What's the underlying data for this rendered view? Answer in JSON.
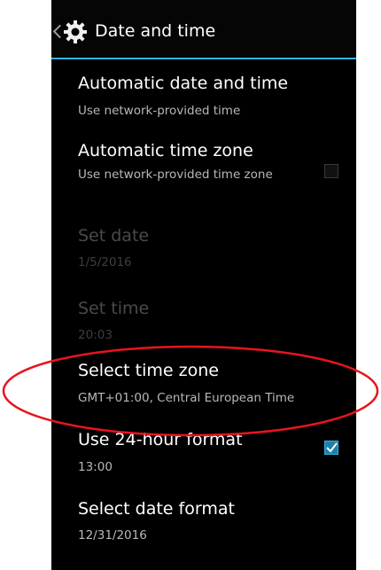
{
  "action_bar": {
    "title": "Date and time"
  },
  "items": [
    {
      "label": "Automatic date and time",
      "summary": "Use network-provided time"
    },
    {
      "label": "Automatic time zone",
      "summary": "Use network-provided time zone",
      "checked": false
    },
    {
      "label": "Set date",
      "summary": "1/5/2016",
      "enabled": false
    },
    {
      "label": "Set time",
      "summary": "20:03",
      "enabled": false
    },
    {
      "label": "Select time zone",
      "summary": "GMT+01:00, Central European Time"
    },
    {
      "label": "Use 24-hour format",
      "summary": "13:00",
      "checked": true
    },
    {
      "label": "Select date format",
      "summary": "12/31/2016"
    }
  ],
  "colors": {
    "accent": "#33b5e5",
    "background": "#000000",
    "annotation": "#e8141c"
  },
  "icons": {
    "back": "back-caret-icon",
    "settings": "gear-icon"
  }
}
